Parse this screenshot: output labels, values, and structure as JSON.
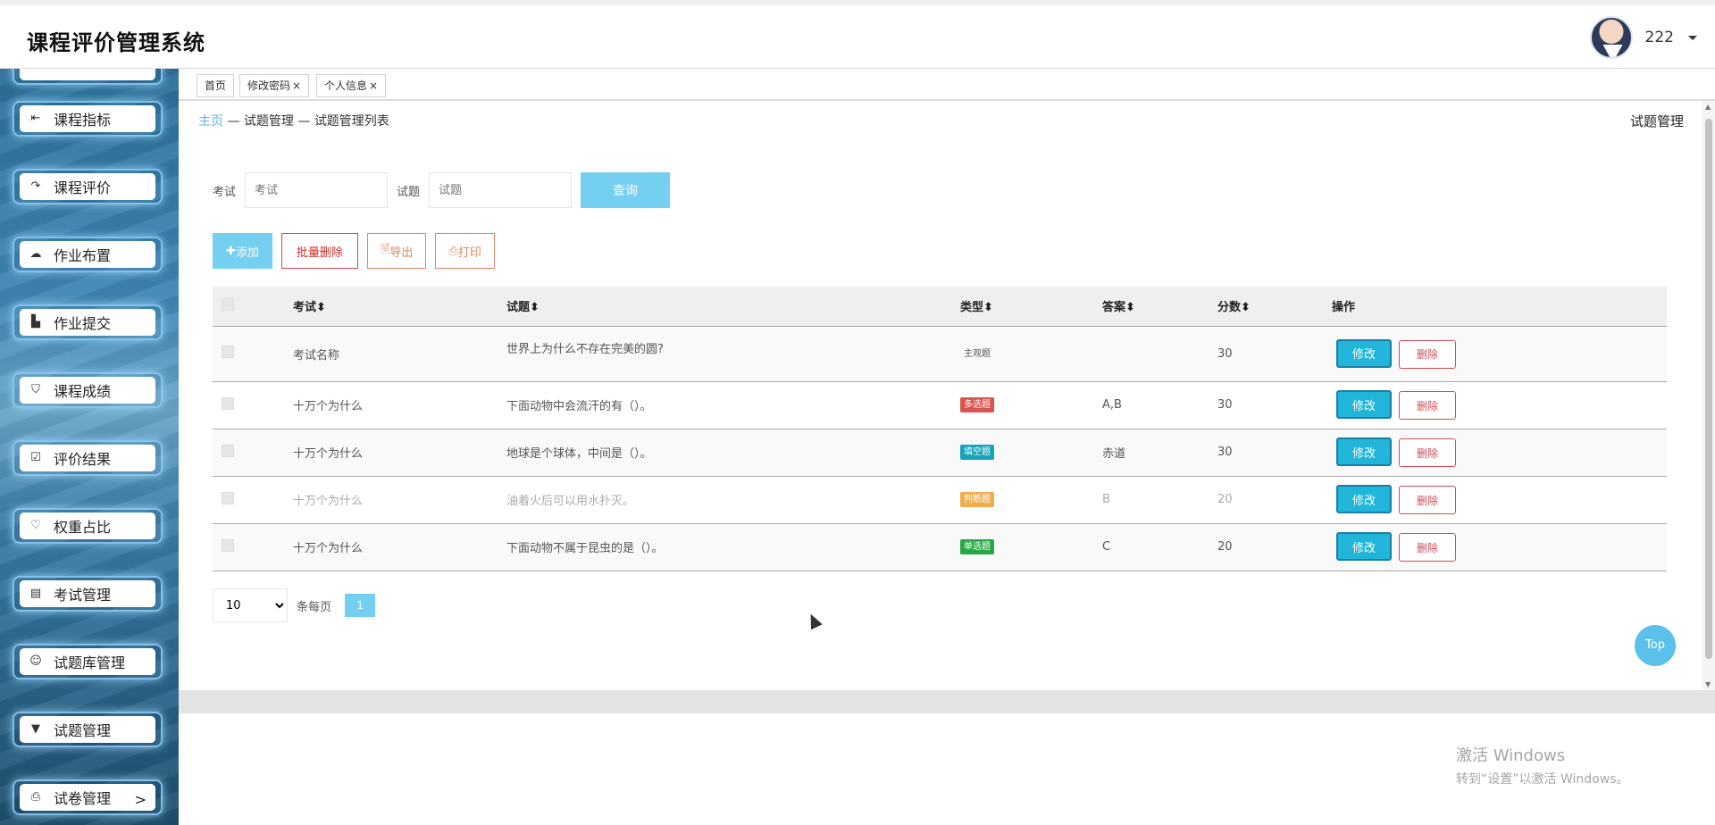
{
  "app": {
    "title": "课程评价管理系统"
  },
  "user": {
    "name": "222"
  },
  "sidebar": {
    "items": [
      {
        "label": "课程指标",
        "icon": "sign-in-icon"
      },
      {
        "label": "课程评价",
        "icon": "share-icon"
      },
      {
        "label": "作业布置",
        "icon": "cloud-icon"
      },
      {
        "label": "作业提交",
        "icon": "bar-chart-icon"
      },
      {
        "label": "课程成绩",
        "icon": "shield-icon"
      },
      {
        "label": "评价结果",
        "icon": "check-square-icon"
      },
      {
        "label": "权重占比",
        "icon": "heart-icon"
      },
      {
        "label": "考试管理",
        "icon": "document-icon"
      },
      {
        "label": "试题库管理",
        "icon": "smile-icon"
      },
      {
        "label": "试题管理",
        "icon": "triangle-down-icon"
      },
      {
        "label": "试卷管理",
        "icon": "printer-icon"
      }
    ]
  },
  "tabs": [
    {
      "label": "首页"
    },
    {
      "label": "修改密码",
      "close": "×"
    },
    {
      "label": "个人信息",
      "close": "×"
    }
  ],
  "breadcrumb": {
    "home": "主页",
    "sep": "—",
    "section": "试题管理",
    "page": "试题管理列表"
  },
  "page_label": "试题管理",
  "search": {
    "exam_label": "考试",
    "exam_placeholder": "考试",
    "question_label": "试题",
    "question_placeholder": "试题",
    "query_button": "查询"
  },
  "actions": {
    "add": "添加",
    "batch_delete": "批量删除",
    "export": "导出",
    "print": "打印"
  },
  "table": {
    "headers": [
      "考试",
      "试题",
      "类型",
      "答案",
      "分数",
      "操作"
    ],
    "rows": [
      {
        "exam": "考试名称",
        "question": "世界上为什么不存在完美的圆?",
        "type": "主观题",
        "answer": "",
        "score": "30"
      },
      {
        "exam": "十万个为什么",
        "question": "下面动物中会流汗的有（）。",
        "type": "多选题",
        "answer": "A,B",
        "score": "30"
      },
      {
        "exam": "十万个为什么",
        "question": "地球是个球体，中间是（）。",
        "type": "填空题",
        "answer": "赤道",
        "score": "30"
      },
      {
        "exam": "十万个为什么",
        "question": "油着火后可以用水扑灭。",
        "type": "判断题",
        "answer": "B",
        "score": "20"
      },
      {
        "exam": "十万个为什么",
        "question": "下面动物不属于昆虫的是（）。",
        "type": "单选题",
        "answer": "C",
        "score": "20"
      }
    ],
    "edit_label": "修改",
    "delete_label": "删除"
  },
  "type_colors": {
    "主观题": "transparent",
    "多选题": "#d9534f",
    "填空题": "#17a2b8",
    "判断题": "#f0ad4e",
    "单选题": "#28a745"
  },
  "pagination": {
    "page_size": "10",
    "per_page_label": "条每页",
    "current_page": "1"
  },
  "top_button": "Top",
  "watermark": {
    "line1": "激活 Windows",
    "line2": "转到“设置”以激活 Windows。"
  }
}
